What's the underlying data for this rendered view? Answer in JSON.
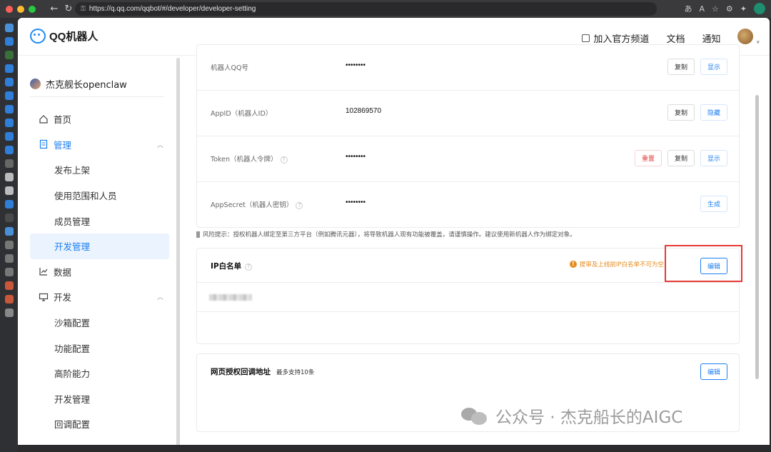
{
  "browser": {
    "url": "https://q.qq.com/qqbot/#/developer/developer-setting"
  },
  "topnav": {
    "logo_text": "QQ机器人",
    "join_channel": "加入官方频道",
    "docs": "文档",
    "notify": "通知"
  },
  "sidebar": {
    "bot_name": "杰克舰长openclaw",
    "items": [
      {
        "label": "首页"
      },
      {
        "label": "管理"
      },
      {
        "label": "发布上架"
      },
      {
        "label": "使用范围和人员"
      },
      {
        "label": "成员管理"
      },
      {
        "label": "开发管理"
      },
      {
        "label": "数据"
      },
      {
        "label": "开发"
      },
      {
        "label": "沙箱配置"
      },
      {
        "label": "功能配置"
      },
      {
        "label": "高阶能力"
      },
      {
        "label": "开发管理"
      },
      {
        "label": "回调配置"
      }
    ]
  },
  "credentials": [
    {
      "label": "机器人QQ号",
      "value": "••••••••",
      "buttons": [
        "复制",
        "显示"
      ]
    },
    {
      "label": "AppID（机器人ID）",
      "value": "102869570",
      "buttons": [
        "复制",
        "隐藏"
      ]
    },
    {
      "label": "Token（机器人令牌）",
      "value": "••••••••",
      "buttons": [
        "重置",
        "复制",
        "显示"
      ]
    },
    {
      "label": "AppSecret（机器人密钥）",
      "value": "••••••••",
      "buttons": [
        "生成"
      ]
    }
  ],
  "risk_text": "风险提示：授权机器人绑定至第三方平台（例如腾讯元器），将导致机器人现有功能被覆盖，请谨慎操作。建议使用新机器人作为绑定对象。",
  "ip_whitelist": {
    "title": "IP白名单",
    "warning": "提审及上线前IP白名单不可为空",
    "edit": "编辑"
  },
  "oauth_callback": {
    "title": "网页授权回调地址",
    "note": "最多支持10条",
    "edit": "编辑"
  },
  "watermark": "公众号 · 杰克船长的AIGC",
  "colors": {
    "accent": "#1e7ff0",
    "danger": "#e23b3b",
    "warning": "#e58a1e",
    "highlight_frame": "#e53935"
  }
}
